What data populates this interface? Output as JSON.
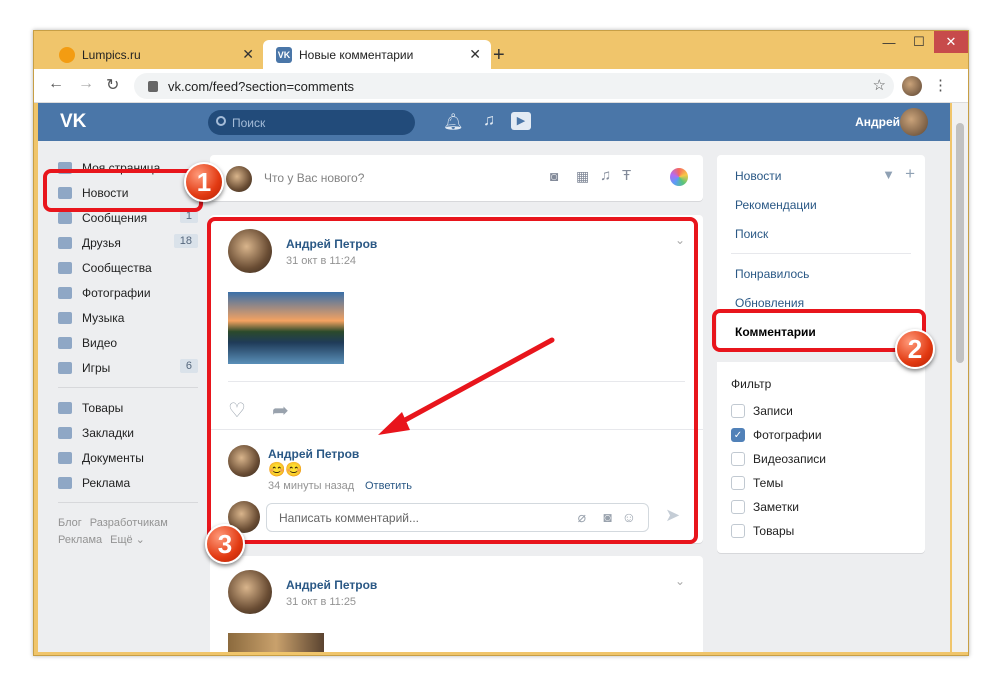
{
  "browser": {
    "tabs": [
      {
        "label": "Lumpics.ru"
      },
      {
        "label": "Новые комментарии"
      }
    ],
    "url": "vk.com/feed?section=comments",
    "new_tab": "+"
  },
  "vk": {
    "logo": "VK",
    "search_placeholder": "Поиск",
    "user_name": "Андрей"
  },
  "left_nav": {
    "items": [
      {
        "label": "Моя страница"
      },
      {
        "label": "Новости"
      },
      {
        "label": "Сообщения",
        "count": "1"
      },
      {
        "label": "Друзья",
        "count": "18"
      },
      {
        "label": "Сообщества"
      },
      {
        "label": "Фотографии"
      },
      {
        "label": "Музыка"
      },
      {
        "label": "Видео"
      },
      {
        "label": "Игры",
        "count": "6"
      }
    ],
    "items2": [
      {
        "label": "Товары"
      },
      {
        "label": "Закладки"
      },
      {
        "label": "Документы"
      },
      {
        "label": "Реклама"
      }
    ],
    "footer": [
      "Блог",
      "Разработчикам",
      "Реклама",
      "Ещё ⌄"
    ]
  },
  "composer": {
    "placeholder": "Что у Вас нового?"
  },
  "post1": {
    "author": "Андрей Петров",
    "date": "31 окт в 11:24",
    "comment": {
      "author": "Андрей Петров",
      "text": "😊😊",
      "time": "34 минуты назад",
      "reply": "Ответить"
    },
    "comment_placeholder": "Написать комментарий..."
  },
  "post2": {
    "author": "Андрей Петров",
    "date": "31 окт в 11:25"
  },
  "right": {
    "menu": [
      "Новости",
      "Рекомендации",
      "Поиск",
      "Понравилось",
      "Обновления",
      "Комментарии"
    ],
    "filter_title": "Фильтр",
    "filters": [
      {
        "label": "Записи",
        "checked": false
      },
      {
        "label": "Фотографии",
        "checked": true
      },
      {
        "label": "Видеозаписи",
        "checked": false
      },
      {
        "label": "Темы",
        "checked": false
      },
      {
        "label": "Заметки",
        "checked": false
      },
      {
        "label": "Товары",
        "checked": false
      }
    ]
  },
  "annotations": {
    "badge1": "1",
    "badge2": "2",
    "badge3": "3"
  },
  "colors": {
    "vk_blue": "#4a76a8",
    "annotation_red": "#e8151c",
    "window_frame": "#f0c56b"
  }
}
